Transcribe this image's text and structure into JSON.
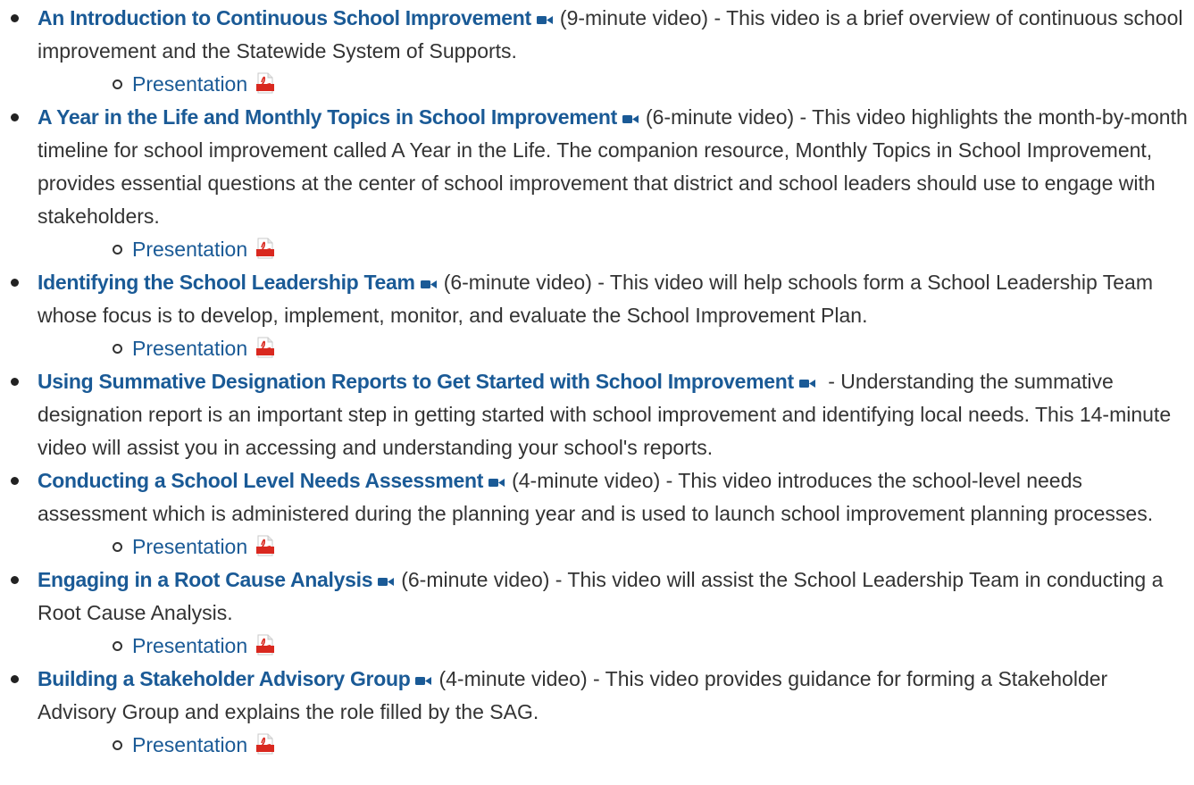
{
  "accent_color": "#1a5a96",
  "pdf_color": "#d9281f",
  "icons": {
    "video": "video-camera-icon",
    "pdf": "pdf-icon"
  },
  "items": [
    {
      "title": "An Introduction to Continuous School Improvement",
      "meta": "(9-minute video) - ",
      "description": "This video is a brief overview of continuous school improvement and the Statewide System of Supports.",
      "presentation": "Presentation"
    },
    {
      "title": "A Year in the Life and Monthly Topics in School Improvement",
      "meta": "(6-minute video) - ",
      "description": "This video highlights the month-by-month timeline for school improvement called A Year in the Life. The companion resource, Monthly Topics in School Improvement, provides essential questions at the center of school improvement that district and school leaders should use to engage with stakeholders.",
      "presentation": "Presentation"
    },
    {
      "title": "Identifying the School Leadership Team",
      "meta": "(6-minute video) - ",
      "description": "This video will help schools form a School Leadership Team whose focus is to develop, implement, monitor, and evaluate the School Improvement Plan.",
      "presentation": "Presentation"
    },
    {
      "title": "Using Summative Designation Reports to Get Started with School Improvement",
      "meta": " - ",
      "description": "Understanding the summative designation report is an important step in getting started with school improvement and identifying local needs. This 14-minute video will assist you in accessing and understanding your school's reports.",
      "presentation": null
    },
    {
      "title": "Conducting a School Level Needs Assessment",
      "meta": "(4-minute video) - ",
      "description": "This video introduces the school-level needs assessment which is administered during the planning year and is used to launch school improvement planning processes.",
      "presentation": "Presentation"
    },
    {
      "title": "Engaging in a Root Cause Analysis",
      "meta": "(6-minute video) - ",
      "description": "This video will assist the School Leadership Team in conducting a Root Cause Analysis.",
      "presentation": "Presentation"
    },
    {
      "title": "Building a Stakeholder Advisory Group",
      "meta": "(4-minute video) - ",
      "description": "This video provides guidance for forming a Stakeholder Advisory Group and explains the role filled by the SAG.",
      "presentation": "Presentation"
    }
  ]
}
